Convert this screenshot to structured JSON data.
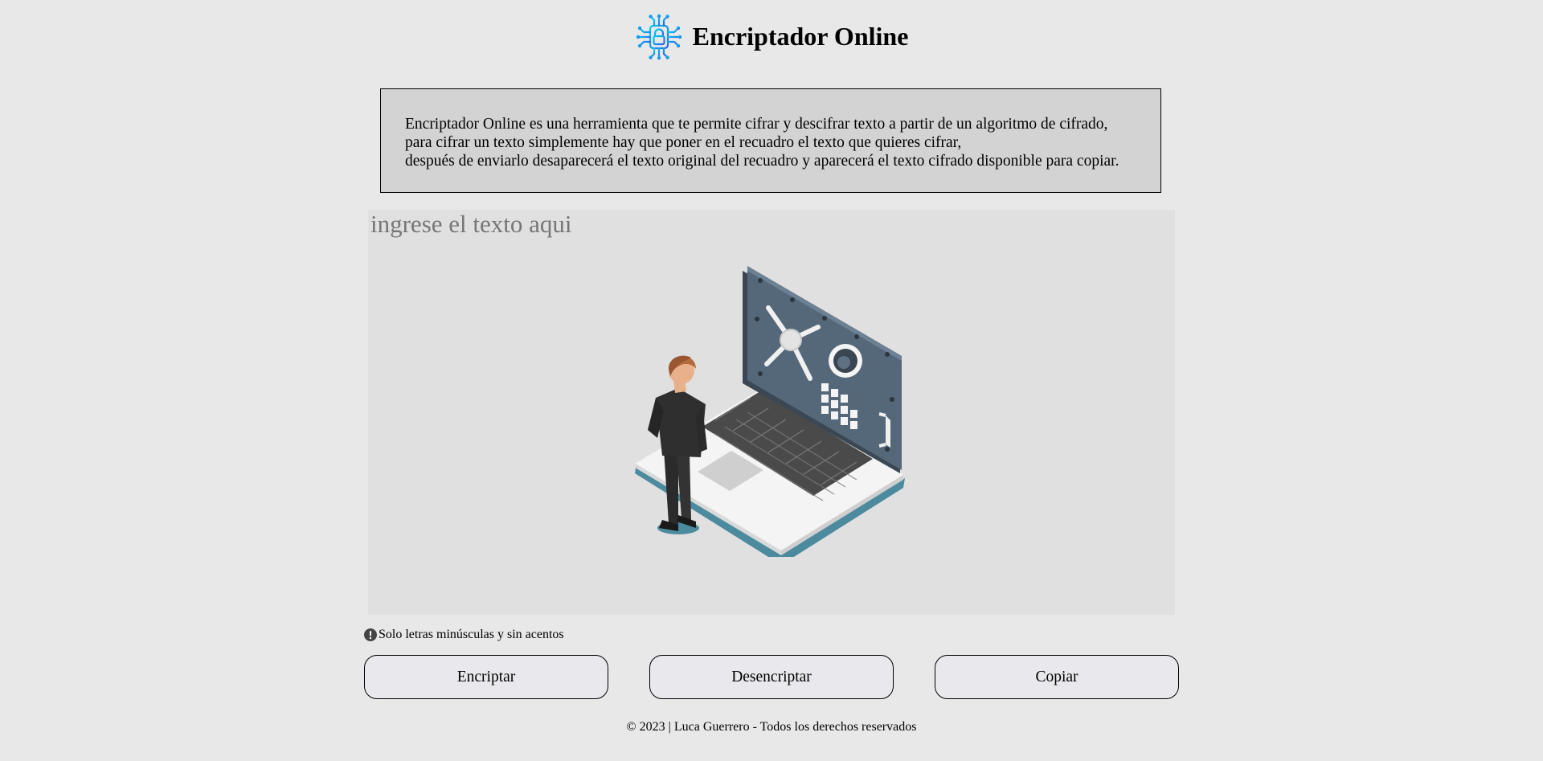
{
  "header": {
    "title": "Encriptador Online",
    "logo_icon": "circuit-lock-icon",
    "logo_colors": [
      "#00c2e8",
      "#2463e4"
    ]
  },
  "description": {
    "lines": [
      "Encriptador Online es una herramienta que te permite cifrar y descifrar texto a partir de un algoritmo de cifrado,",
      "para cifrar un texto simplemente hay que poner en el recuadro el texto que quieres cifrar,",
      "después de enviarlo desaparecerá el texto original del recuadro y aparecerá el texto cifrado disponible para copiar."
    ]
  },
  "input": {
    "value": "",
    "placeholder": "ingrese el texto aqui"
  },
  "illustration": {
    "icon": "man-laptop-safe-illustration"
  },
  "hint": {
    "icon": "exclamation-circle-icon",
    "text": "Solo letras minúsculas y sin acentos"
  },
  "buttons": {
    "encrypt": "Encriptar",
    "decrypt": "Desencriptar",
    "copy": "Copiar"
  },
  "footer": {
    "text": "© 2023 | Luca Guerrero - Todos los derechos reservados"
  },
  "colors": {
    "page_background": "#e8e8e8",
    "description_background": "#d2d3d2",
    "input_background": "#e0e0e0",
    "button_background": "#e9e9ed"
  }
}
